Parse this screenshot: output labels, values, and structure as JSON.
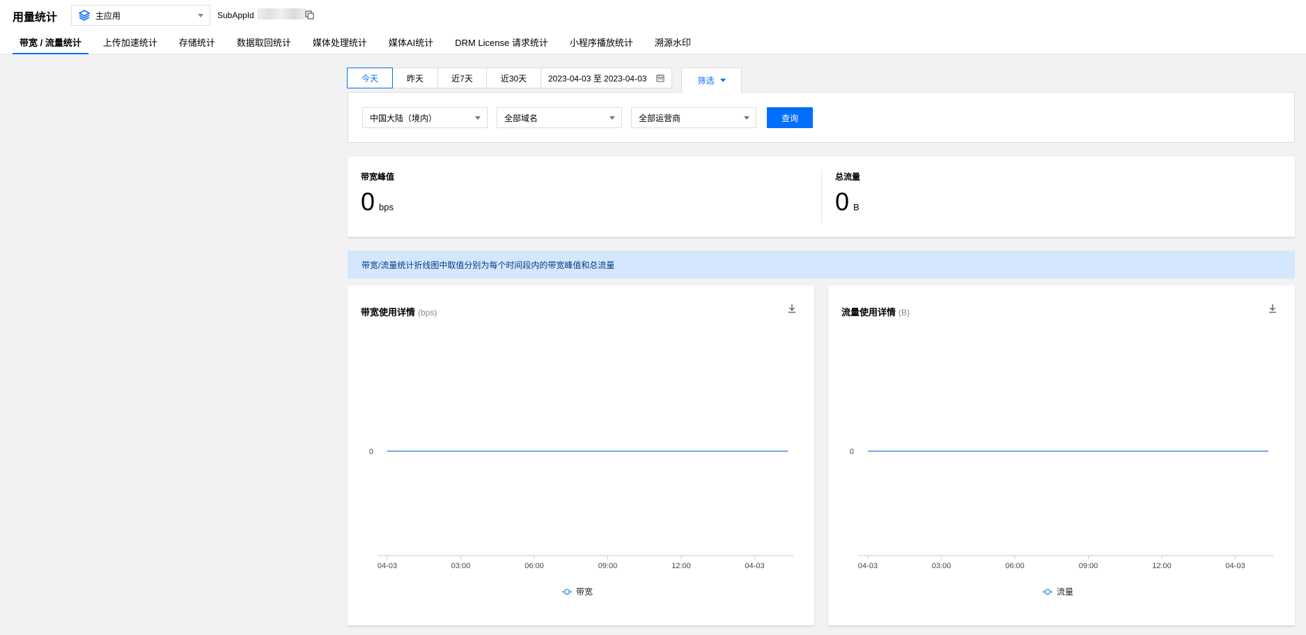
{
  "header": {
    "title": "用量统计",
    "app_select": {
      "value": "主应用",
      "icon": "layers-icon"
    },
    "subappid_label": "SubAppId"
  },
  "tabs": [
    {
      "label": "带宽 / 流量统计",
      "active": true
    },
    {
      "label": "上传加速统计",
      "active": false
    },
    {
      "label": "存储统计",
      "active": false
    },
    {
      "label": "数据取回统计",
      "active": false
    },
    {
      "label": "媒体处理统计",
      "active": false
    },
    {
      "label": "媒体AI统计",
      "active": false
    },
    {
      "label": "DRM License 请求统计",
      "active": false
    },
    {
      "label": "小程序播放统计",
      "active": false
    },
    {
      "label": "溯源水印",
      "active": false
    }
  ],
  "date_bar": {
    "buttons": [
      {
        "label": "今天",
        "active": true
      },
      {
        "label": "昨天",
        "active": false
      },
      {
        "label": "近7天",
        "active": false
      },
      {
        "label": "近30天",
        "active": false
      }
    ],
    "range": "2023-04-03 至 2023-04-03",
    "filter_label": "筛选"
  },
  "filters": {
    "region": "中国大陆（境内）",
    "domain": "全部域名",
    "isp": "全部运营商",
    "query_label": "查询"
  },
  "summary": {
    "bandwidth_peak": {
      "label": "带宽峰值",
      "value": "0",
      "unit": "bps"
    },
    "total_traffic": {
      "label": "总流量",
      "value": "0",
      "unit": "B"
    }
  },
  "info_text": "带宽/流量统计折线图中取值分别为每个时间段内的带宽峰值和总流量",
  "colors": {
    "accent": "#006eff",
    "series": "#6ea8e8",
    "info_bg": "#d5e7fd"
  },
  "chart_data": [
    {
      "type": "line",
      "title": "带宽使用详情",
      "unit_label": "(bps)",
      "x_ticks": [
        "04-03",
        "03:00",
        "06:00",
        "09:00",
        "12:00",
        "04-03"
      ],
      "y_ticks": [
        "0"
      ],
      "series": [
        {
          "name": "带宽",
          "values": [
            0,
            0
          ]
        }
      ],
      "legend": "bottom-center"
    },
    {
      "type": "line",
      "title": "流量使用详情",
      "unit_label": "(B)",
      "x_ticks": [
        "04-03",
        "03:00",
        "06:00",
        "09:00",
        "12:00",
        "04-03"
      ],
      "y_ticks": [
        "0"
      ],
      "series": [
        {
          "name": "流量",
          "values": [
            0,
            0
          ]
        }
      ],
      "legend": "bottom-center"
    }
  ]
}
